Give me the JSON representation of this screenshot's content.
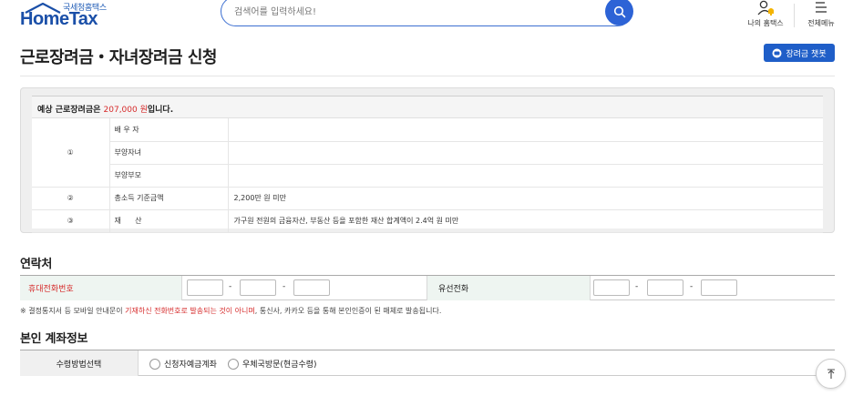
{
  "header": {
    "logo_sub": "국세청홈택스",
    "logo_main": "HomeTax",
    "search_placeholder": "검색어를 입력하세요!",
    "my_hometax": "나의 홈택스",
    "all_menu": "전체메뉴"
  },
  "page": {
    "title": "근로장려금・자녀장려금 신청",
    "chatbot_button": "장려금 챗봇"
  },
  "estimate": {
    "prefix": "예상 근로장려금은 ",
    "amount": "207,000 원",
    "suffix": "입니다.",
    "rows": [
      {
        "num": "",
        "label": "배 우 자",
        "value": ""
      },
      {
        "num": "①",
        "label": "부양자녀",
        "value": ""
      },
      {
        "num": "",
        "label": "부양부모",
        "value": ""
      },
      {
        "num": "②",
        "label": "총소득 기준금액",
        "value": "2,200만 원 미만"
      },
      {
        "num": "③",
        "label": "재      산",
        "value": "가구원 전원의 금융자산, 부동산 등을 포함한 재산 합계액이 2.4억 원 미만"
      }
    ]
  },
  "contact": {
    "section_title": "연락처",
    "mobile_label": "휴대전화번호",
    "landline_label": "유선전화",
    "dash": "-",
    "notice_pre": "※ 결정통지서 등 모바일 안내문이 ",
    "notice_red": "기재하신 전화번호로 발송되는 것이 아니며",
    "notice_post": ", 통신사, 카카오 등을 통해 본인인증이 된 매체로 발송됩니다."
  },
  "account": {
    "section_title": "본인 계좌정보",
    "method_label": "수령방법선택",
    "option1": "신청자예금계좌",
    "option2": "우체국방문(현금수령)"
  },
  "colors": {
    "brand_blue": "#1f5ec8",
    "highlight_red": "#d62b2b",
    "label_green_bg": "#eef5f1"
  }
}
